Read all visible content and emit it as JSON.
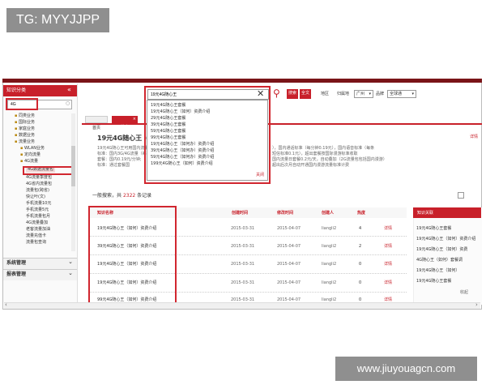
{
  "watermark_top": "TG: MYYJJPP",
  "watermark_bottom": "www.jiuyouagcn.com",
  "colors": {
    "brand_red": "#c8202a",
    "annotation_red": "#d1262f",
    "gray_tag": "#8f8f8f"
  },
  "sidebar": {
    "title": "知识分类",
    "search_value": "4G",
    "tree": [
      "同类业务",
      "国际业务",
      "家庭业务",
      "数据业务",
      "流量业务",
      "WLAN业务",
      "定向流量",
      "4G流量",
      "4G数据流量包",
      "4G流量季度包",
      "4G省内流量包",
      "流量包(跨省)",
      "快让叶(文)",
      "手机流量10元",
      "手机流量5元",
      "手机流量包月",
      "4G流量叠加",
      "老客流量加油",
      "流量充值卡",
      "流量包查询"
    ],
    "bottom_items": [
      "系统管理",
      "报表管理"
    ]
  },
  "search": {
    "value": "19元4G随心王",
    "search_btn": "搜索",
    "fulltext_btn": "全文",
    "region_label": "地区",
    "region_value": "广州",
    "city_label": "归属地",
    "brand_label": "品牌",
    "brand_value": "全球通",
    "suggestions": [
      "19元4G随心王套餐",
      "19元4G随心王（如何）资费介绍",
      "29元4G随心王套餐",
      "39元4G随心王套餐",
      "59元4G随心王套餐",
      "99元4G随心王套餐",
      "19元4G随心王（如何办）资费介绍",
      "39元4G随心王（如何办）资费介绍",
      "59元4G随心王（如何办）资费介绍",
      "199元4G随心王（如何）资费介绍"
    ],
    "close_link": "关闭"
  },
  "tabs": [
    "首页",
    "搜索"
  ],
  "article": {
    "title": "19元4G随心王（",
    "link": "详情",
    "snippet_lines": [
      "19元4G随心王可用国内流量（每分钟",
      "标准：国内3G/4G流量（每分钟",
      "套餐：国内0.19元/分钟;",
      "标准：通过套餐国",
      "），国内通话标准（每分钟0.19元），国内语音标准（每条",
      "短信标准0.1元），超出套餐按国际漫游标准收取",
      "国内流量日套餐0.2元/天，自动叠加（2G流量包包括国内漫游）",
      "超出后次月自动开通国内漫游流量标准计费"
    ]
  },
  "results": {
    "count_prefix": "一般搜索，共",
    "count": "2322",
    "count_suffix": "条记录",
    "columns": [
      "知识名称",
      "创建时间",
      "修改时间",
      "创建人",
      "热度",
      ""
    ],
    "rows": [
      [
        "19元4G随心王（如何）资费介绍",
        "2015-03-31",
        "2015-04-07",
        "liangli2",
        "4",
        "详情"
      ],
      [
        "39元4G随心王（如何）资费介绍",
        "2015-03-31",
        "2015-04-07",
        "liangli2",
        "2",
        "详情"
      ],
      [
        "19元4G随心王（如何）资费介绍",
        "2015-03-31",
        "2015-04-07",
        "liangli2",
        "0",
        "详情"
      ],
      [
        "19元4G随心王（如何）资费介绍",
        "2015-03-31",
        "2015-04-07",
        "liangli2",
        "0",
        "详情"
      ],
      [
        "99元4G随心王（如何）资费介绍",
        "2015-03-31",
        "2015-04-07",
        "liangli2",
        "0",
        "详情"
      ]
    ]
  },
  "related": {
    "title": "知识关联",
    "items": [
      "19元4G随心王套餐",
      "19元4G随心王（如何）资费介绍",
      "19元4G随心王（如何）资费",
      "4G随心王（如何）套餐调",
      "19元4G随心王（如何）",
      "19元4G随心王套餐"
    ],
    "toggle_label": "收起"
  }
}
